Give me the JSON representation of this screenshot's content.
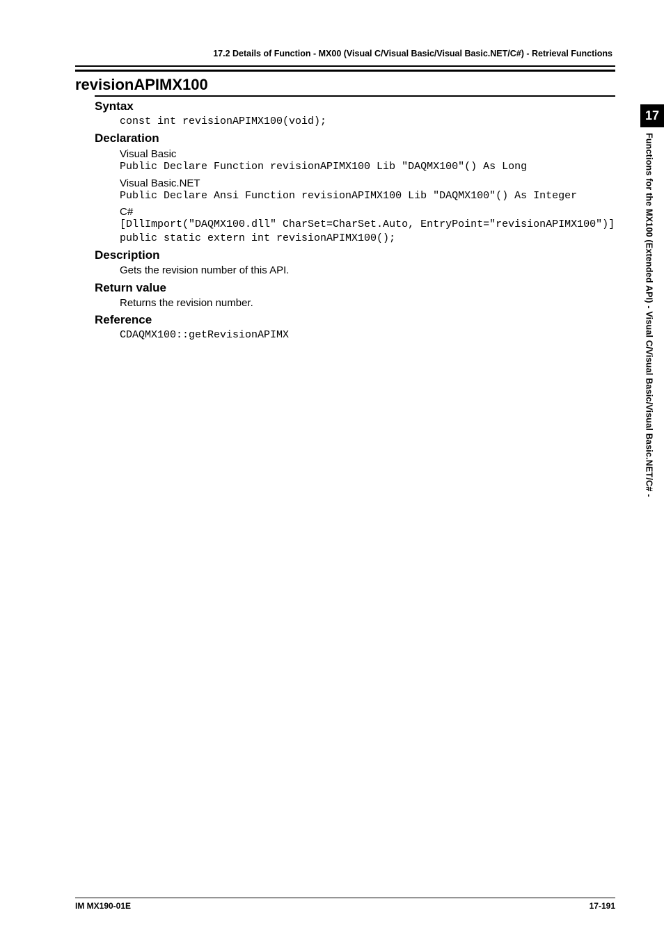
{
  "running_head": "17.2  Details of  Function - MX00 (Visual C/Visual Basic/Visual Basic.NET/C#) - Retrieval Functions",
  "section_title": "revisionAPIMX100",
  "syntax": {
    "heading": "Syntax",
    "code": "const int revisionAPIMX100(void);"
  },
  "declaration": {
    "heading": "Declaration",
    "vb_label": "Visual Basic",
    "vb_code": "Public Declare Function revisionAPIMX100 Lib \"DAQMX100\"() As Long",
    "vbnet_label": "Visual Basic.NET",
    "vbnet_code": "Public Declare Ansi Function revisionAPIMX100 Lib \"DAQMX100\"() As Integer",
    "cs_label": "C#",
    "cs_code": "[DllImport(\"DAQMX100.dll\" CharSet=CharSet.Auto, EntryPoint=\"revisionAPIMX100\")]\npublic static extern int revisionAPIMX100();"
  },
  "description": {
    "heading": "Description",
    "text": "Gets the revision number of this API."
  },
  "return_value": {
    "heading": "Return value",
    "text": "Returns the revision number."
  },
  "reference": {
    "heading": "Reference",
    "code": "CDAQMX100::getRevisionAPIMX"
  },
  "side_tab": {
    "number": "17",
    "label": "Functions for the MX100 (Extended API)  -  Visual C/Visual Basic/Visual Basic.NET/C#  -"
  },
  "footer": {
    "left": "IM MX190-01E",
    "right": "17-191"
  }
}
